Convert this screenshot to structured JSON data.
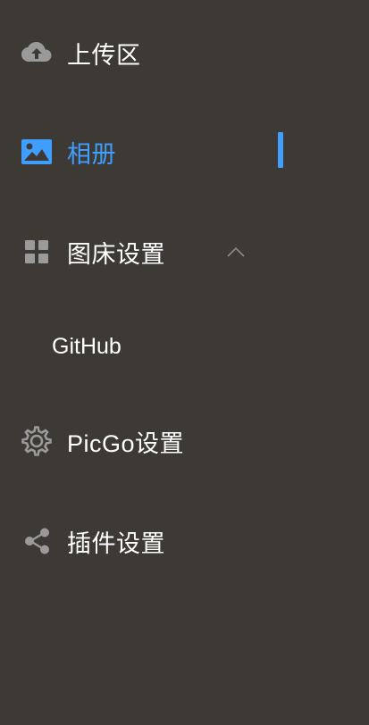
{
  "colors": {
    "background": "#3d3a35",
    "text": "#ffffff",
    "accent": "#409eff",
    "icon": "#9a9a9a"
  },
  "menu": {
    "upload": {
      "label": "上传区",
      "icon": "cloud-upload-icon"
    },
    "gallery": {
      "label": "相册",
      "icon": "image-icon",
      "active": true
    },
    "pic_bed": {
      "label": "图床设置",
      "icon": "grid-icon",
      "expanded": true,
      "children": [
        {
          "label": "GitHub"
        }
      ]
    },
    "picgo_settings": {
      "label": "PicGo设置",
      "icon": "gear-icon"
    },
    "plugin_settings": {
      "label": "插件设置",
      "icon": "share-icon"
    }
  }
}
